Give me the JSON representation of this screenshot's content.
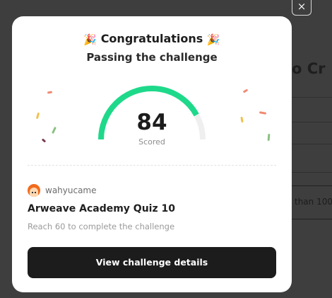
{
  "background": {
    "heading_fragment": "bo Cr",
    "text_fragment": "than 100"
  },
  "modal": {
    "close_glyph": "×",
    "title": "Congratulations",
    "party_icon": "🎉",
    "subtitle": "Passing the challenge",
    "score": "84",
    "score_label": "Scored",
    "score_progress": 0.84,
    "username": "wahyucame",
    "quiz_title": "Arweave Academy Quiz 10",
    "quiz_description": "Reach 60 to complete the challenge",
    "cta_label": "View challenge details"
  },
  "colors": {
    "gauge_fill": "#1ed98a",
    "gauge_track": "#efefef",
    "cta_background": "#1c1c1c",
    "avatar": "#f26b1d"
  },
  "icons": [
    "close-icon",
    "party-popper-icon",
    "avatar-icon",
    "confetti-decoration"
  ]
}
